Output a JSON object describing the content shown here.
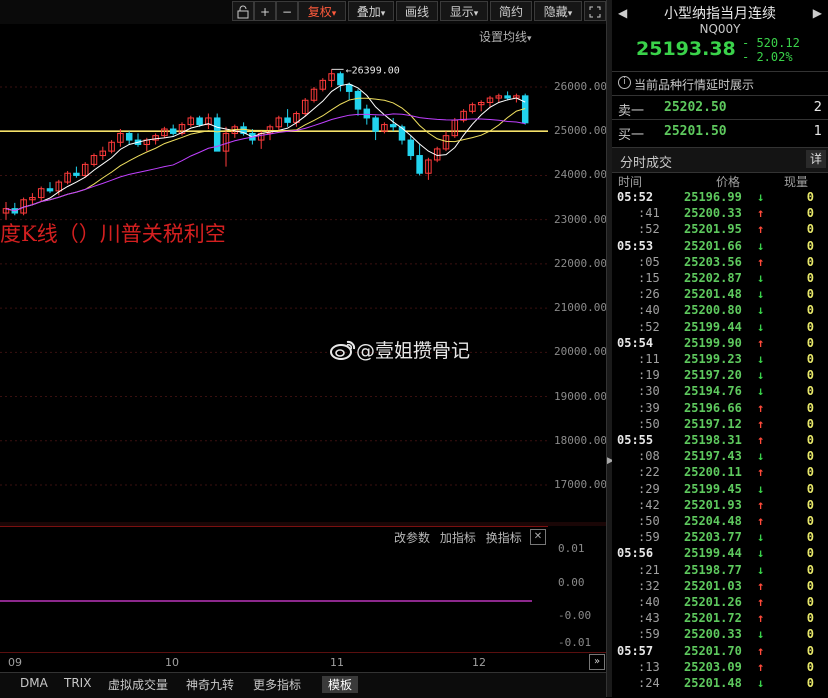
{
  "toolbar": {
    "icons": [
      "lock-icon",
      "plus-icon",
      "minus-icon"
    ],
    "buttons": [
      {
        "label": "复权",
        "arrow": "▾",
        "active": true
      },
      {
        "label": "叠加",
        "arrow": "▾",
        "active": false
      },
      {
        "label": "画线",
        "arrow": "",
        "active": false
      },
      {
        "label": "显示",
        "arrow": "▾",
        "active": false
      },
      {
        "label": "简约",
        "arrow": "",
        "active": false
      },
      {
        "label": "隐藏",
        "arrow": "▾",
        "active": false
      }
    ],
    "settings_label": "设置均线",
    "settings_arrow": "▾"
  },
  "chart": {
    "annotation_high": "26399.00",
    "overlay_text": "度K线（）川普关税利空",
    "watermark": "@壹姐攒骨记",
    "colors": {
      "up": "#ff3b3b",
      "down": "#22d3ee",
      "ma5": "#ffffff",
      "ma10": "#ff5ad2",
      "ma20": "#c040ff",
      "level": "#f5e16a"
    }
  },
  "chart_data": {
    "type": "candlestick",
    "yticks": [
      "26000.00",
      "25000.00",
      "24000.00",
      "23000.00",
      "22000.00",
      "21000.00",
      "20000.00",
      "19000.00",
      "18000.00",
      "17000.00"
    ],
    "ylim": [
      16500,
      26900
    ],
    "level_line": 25000,
    "x_labels": [
      "09",
      "10",
      "11",
      "12"
    ],
    "candles": [
      [
        23150,
        23400,
        23000,
        23250
      ],
      [
        23250,
        23380,
        23100,
        23150
      ],
      [
        23150,
        23500,
        23100,
        23450
      ],
      [
        23450,
        23600,
        23350,
        23500
      ],
      [
        23500,
        23750,
        23400,
        23700
      ],
      [
        23700,
        23850,
        23600,
        23650
      ],
      [
        23650,
        23900,
        23550,
        23850
      ],
      [
        23850,
        24100,
        23800,
        24050
      ],
      [
        24050,
        24200,
        23950,
        24000
      ],
      [
        24000,
        24300,
        23950,
        24250
      ],
      [
        24250,
        24500,
        24200,
        24450
      ],
      [
        24450,
        24650,
        24350,
        24550
      ],
      [
        24550,
        24800,
        24500,
        24750
      ],
      [
        24750,
        25050,
        24650,
        24950
      ],
      [
        24950,
        25000,
        24700,
        24800
      ],
      [
        24800,
        24950,
        24650,
        24700
      ],
      [
        24700,
        24850,
        24550,
        24800
      ],
      [
        24800,
        24950,
        24700,
        24900
      ],
      [
        24900,
        25100,
        24850,
        25050
      ],
      [
        25050,
        25150,
        24900,
        24950
      ],
      [
        24950,
        25200,
        24900,
        25150
      ],
      [
        25150,
        25350,
        25100,
        25300
      ],
      [
        25300,
        25350,
        25100,
        25150
      ],
      [
        25150,
        25400,
        25050,
        25300
      ],
      [
        25300,
        25400,
        24800,
        24550
      ],
      [
        24550,
        25100,
        24200,
        24950
      ],
      [
        24950,
        25150,
        24850,
        25100
      ],
      [
        25100,
        25200,
        24900,
        24950
      ],
      [
        24950,
        25050,
        24700,
        24800
      ],
      [
        24800,
        25000,
        24600,
        24950
      ],
      [
        24950,
        25150,
        24800,
        25100
      ],
      [
        25100,
        25350,
        25000,
        25300
      ],
      [
        25300,
        25500,
        25100,
        25200
      ],
      [
        25200,
        25450,
        25100,
        25400
      ],
      [
        25400,
        25750,
        25350,
        25700
      ],
      [
        25700,
        26000,
        25650,
        25950
      ],
      [
        25950,
        26200,
        25900,
        26150
      ],
      [
        26150,
        26399,
        26000,
        26300
      ],
      [
        26300,
        26350,
        25900,
        26050
      ],
      [
        26050,
        26100,
        25700,
        25900
      ],
      [
        25900,
        25950,
        25350,
        25500
      ],
      [
        25500,
        25600,
        25150,
        25300
      ],
      [
        25300,
        25350,
        24800,
        25000
      ],
      [
        25000,
        25200,
        24950,
        25150
      ],
      [
        25150,
        25300,
        25000,
        25100
      ],
      [
        25100,
        25150,
        24700,
        24800
      ],
      [
        24800,
        24900,
        24350,
        24450
      ],
      [
        24450,
        24700,
        24000,
        24050
      ],
      [
        24050,
        24400,
        23900,
        24350
      ],
      [
        24350,
        24650,
        24300,
        24600
      ],
      [
        24600,
        25000,
        24550,
        24900
      ],
      [
        24900,
        25300,
        24850,
        25250
      ],
      [
        25250,
        25500,
        25200,
        25450
      ],
      [
        25450,
        25650,
        25400,
        25600
      ],
      [
        25600,
        25700,
        25450,
        25650
      ],
      [
        25650,
        25800,
        25550,
        25750
      ],
      [
        25750,
        25850,
        25650,
        25800
      ],
      [
        25800,
        25900,
        25700,
        25750
      ],
      [
        25750,
        25850,
        25650,
        25800
      ],
      [
        25800,
        25850,
        25150,
        25190
      ]
    ],
    "sub_yticks": [
      "0.01",
      "0.00",
      "-0.00",
      "-0.01"
    ]
  },
  "sub_panel": {
    "links": [
      "改参数",
      "加指标",
      "换指标"
    ],
    "close_icon": "✕"
  },
  "bottom_tabs": [
    "DMA",
    "TRIX",
    "虚拟成交量",
    "神奇九转",
    "更多指标",
    "模板"
  ],
  "bottom_selected": "模板",
  "quote": {
    "name": "小型纳指当月连续",
    "code": "NQ00Y",
    "price": "25193.38",
    "change": "- 520.12",
    "change_pct": "- 2.02%",
    "info_text": "当前品种行情延时展示",
    "sell_label": "卖一",
    "sell_price": "25202.50",
    "sell_vol": "2",
    "buy_label": "买一",
    "buy_price": "25201.50",
    "buy_vol": "1",
    "ticks_title": "分时成交",
    "detail_label": "详",
    "col_time": "时间",
    "col_price": "价格",
    "col_vol": "现量"
  },
  "ticks": [
    {
      "t": "05:52",
      "p": "25196.99",
      "d": "down",
      "v": "0",
      "main": true
    },
    {
      "t": ":41",
      "p": "25200.33",
      "d": "up",
      "v": "0"
    },
    {
      "t": ":52",
      "p": "25201.95",
      "d": "up",
      "v": "0"
    },
    {
      "t": "05:53",
      "p": "25201.66",
      "d": "down",
      "v": "0",
      "main": true
    },
    {
      "t": ":05",
      "p": "25203.56",
      "d": "up",
      "v": "0"
    },
    {
      "t": ":15",
      "p": "25202.87",
      "d": "down",
      "v": "0"
    },
    {
      "t": ":26",
      "p": "25201.48",
      "d": "down",
      "v": "0"
    },
    {
      "t": ":40",
      "p": "25200.80",
      "d": "down",
      "v": "0"
    },
    {
      "t": ":52",
      "p": "25199.44",
      "d": "down",
      "v": "0"
    },
    {
      "t": "05:54",
      "p": "25199.90",
      "d": "up",
      "v": "0",
      "main": true
    },
    {
      "t": ":11",
      "p": "25199.23",
      "d": "down",
      "v": "0"
    },
    {
      "t": ":19",
      "p": "25197.20",
      "d": "down",
      "v": "0"
    },
    {
      "t": ":30",
      "p": "25194.76",
      "d": "down",
      "v": "0"
    },
    {
      "t": ":39",
      "p": "25196.66",
      "d": "up",
      "v": "0"
    },
    {
      "t": ":50",
      "p": "25197.12",
      "d": "up",
      "v": "0"
    },
    {
      "t": "05:55",
      "p": "25198.31",
      "d": "up",
      "v": "0",
      "main": true
    },
    {
      "t": ":08",
      "p": "25197.43",
      "d": "down",
      "v": "0"
    },
    {
      "t": ":22",
      "p": "25200.11",
      "d": "up",
      "v": "0"
    },
    {
      "t": ":29",
      "p": "25199.45",
      "d": "down",
      "v": "0"
    },
    {
      "t": ":42",
      "p": "25201.93",
      "d": "up",
      "v": "0"
    },
    {
      "t": ":50",
      "p": "25204.48",
      "d": "up",
      "v": "0"
    },
    {
      "t": ":59",
      "p": "25203.77",
      "d": "down",
      "v": "0"
    },
    {
      "t": "05:56",
      "p": "25199.44",
      "d": "down",
      "v": "0",
      "main": true
    },
    {
      "t": ":21",
      "p": "25198.77",
      "d": "down",
      "v": "0"
    },
    {
      "t": ":32",
      "p": "25201.03",
      "d": "up",
      "v": "0"
    },
    {
      "t": ":40",
      "p": "25201.26",
      "d": "up",
      "v": "0"
    },
    {
      "t": ":43",
      "p": "25201.72",
      "d": "up",
      "v": "0"
    },
    {
      "t": ":59",
      "p": "25200.33",
      "d": "down",
      "v": "0"
    },
    {
      "t": "05:57",
      "p": "25201.70",
      "d": "up",
      "v": "0",
      "main": true
    },
    {
      "t": ":13",
      "p": "25203.09",
      "d": "up",
      "v": "0"
    },
    {
      "t": ":24",
      "p": "25201.48",
      "d": "down",
      "v": "0"
    }
  ]
}
